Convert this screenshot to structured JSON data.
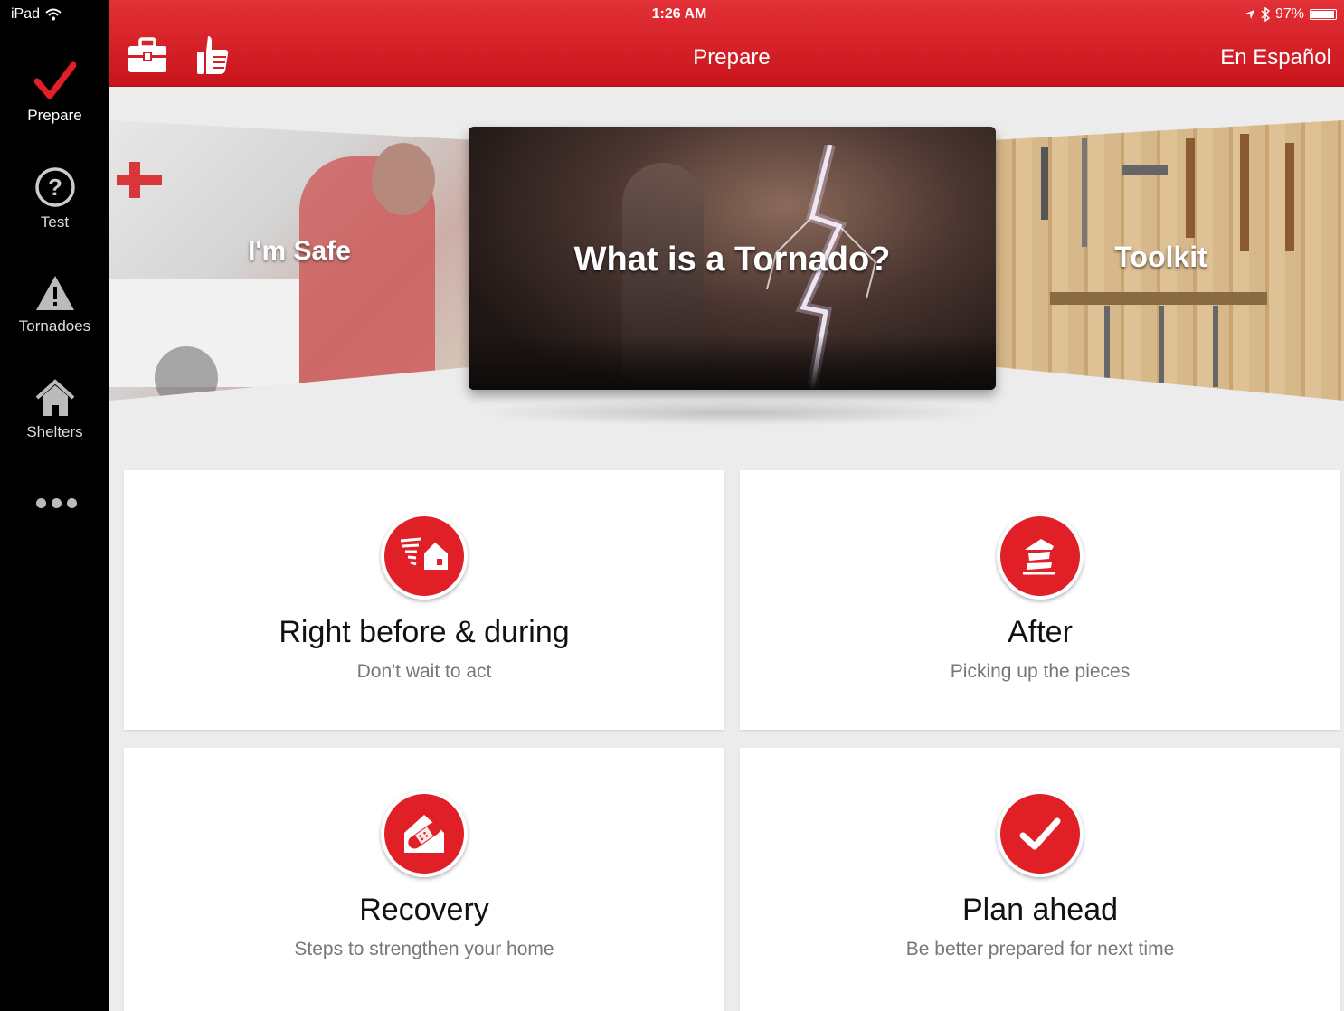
{
  "status": {
    "device": "iPad",
    "time": "1:26 AM",
    "battery": "97%"
  },
  "sidebar": {
    "items": [
      {
        "label": "Prepare",
        "icon": "checkmark-icon"
      },
      {
        "label": "Test",
        "icon": "question-icon"
      },
      {
        "label": "Tornadoes",
        "icon": "warning-icon"
      },
      {
        "label": "Shelters",
        "icon": "home-icon"
      }
    ],
    "more_icon": "more-dots-icon"
  },
  "header": {
    "title": "Prepare",
    "language_link": "En Español",
    "left_icons": [
      "toolkit-icon",
      "thumbs-up-icon"
    ]
  },
  "carousel": {
    "panels": [
      {
        "label": "I'm Safe"
      },
      {
        "label": "What is a Tornado?"
      },
      {
        "label": "Toolkit"
      }
    ]
  },
  "cards": [
    {
      "title": "Right before & during",
      "subtitle": "Don't wait to act",
      "icon": "tornado-house-icon"
    },
    {
      "title": "After",
      "subtitle": "Picking up the pieces",
      "icon": "damaged-house-icon"
    },
    {
      "title": "Recovery",
      "subtitle": "Steps to strengthen your home",
      "icon": "bandaged-house-icon"
    },
    {
      "title": "Plan ahead",
      "subtitle": "Be better prepared for next time",
      "icon": "checkmark-icon"
    }
  ],
  "colors": {
    "brand_red": "#e01f26",
    "header_red": "#d42029",
    "sidebar_bg": "#000000",
    "main_bg": "#ececec"
  }
}
